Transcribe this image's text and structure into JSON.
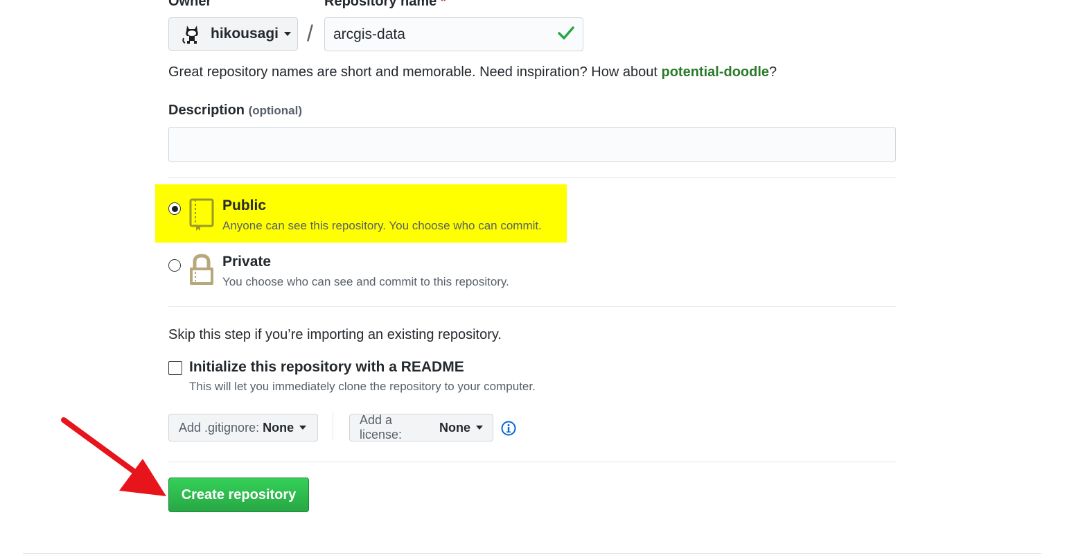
{
  "form": {
    "owner_label": "Owner",
    "repo_name_label": "Repository name",
    "required_mark": "*",
    "owner_value": "hikousagi",
    "slash": "/",
    "repo_name_value": "arcgis-data",
    "name_hint_prefix": "Great repository names are short and memorable. Need inspiration? How about ",
    "name_suggestion": "potential-doodle",
    "name_hint_suffix": "?",
    "description_label": "Description",
    "description_optional": "(optional)",
    "description_value": ""
  },
  "visibility": {
    "selected": "public",
    "public_title": "Public",
    "public_note": "Anyone can see this repository. You choose who can commit.",
    "private_title": "Private",
    "private_note": "You choose who can see and commit to this repository."
  },
  "init": {
    "skip_text": "Skip this step if you’re importing an existing repository.",
    "readme_title": "Initialize this repository with a README",
    "readme_note": "This will let you immediately clone the repository to your computer.",
    "readme_checked": false,
    "gitignore_label": "Add .gitignore:",
    "gitignore_value": "None",
    "license_label": "Add a license:",
    "license_value": "None",
    "info_icon": "info-icon"
  },
  "actions": {
    "create_label": "Create repository"
  },
  "annotations": {
    "highlight_color": "#ffff00",
    "arrow_color": "#e8141b"
  },
  "colors": {
    "valid_check": "#28a745",
    "suggestion": "#2c7a2c",
    "create_button": "#28a745"
  }
}
